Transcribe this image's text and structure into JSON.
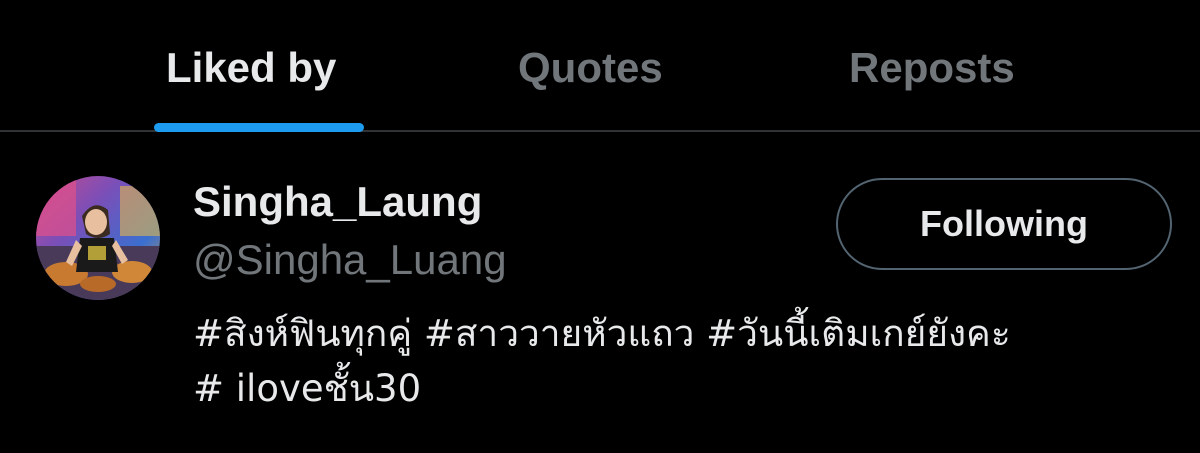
{
  "tabs": [
    {
      "label": "Liked by",
      "active": true
    },
    {
      "label": "Quotes",
      "active": false
    },
    {
      "label": "Reposts",
      "active": false
    }
  ],
  "user": {
    "display_name": "Singha_Laung",
    "handle": "@Singha_Luang",
    "bio_lines": [
      "#สิงห์ฟินทุกคู่ #สาววายหัวแถว #วันนี้เติมเกย์ยังคะ",
      "# iloveชั้น30"
    ],
    "follow_button_label": "Following"
  },
  "colors": {
    "background": "#000000",
    "primary_text": "#e7e9ea",
    "secondary_text": "#71767b",
    "accent": "#1d9bf0",
    "divider": "#2f3336",
    "button_border": "#536471"
  }
}
